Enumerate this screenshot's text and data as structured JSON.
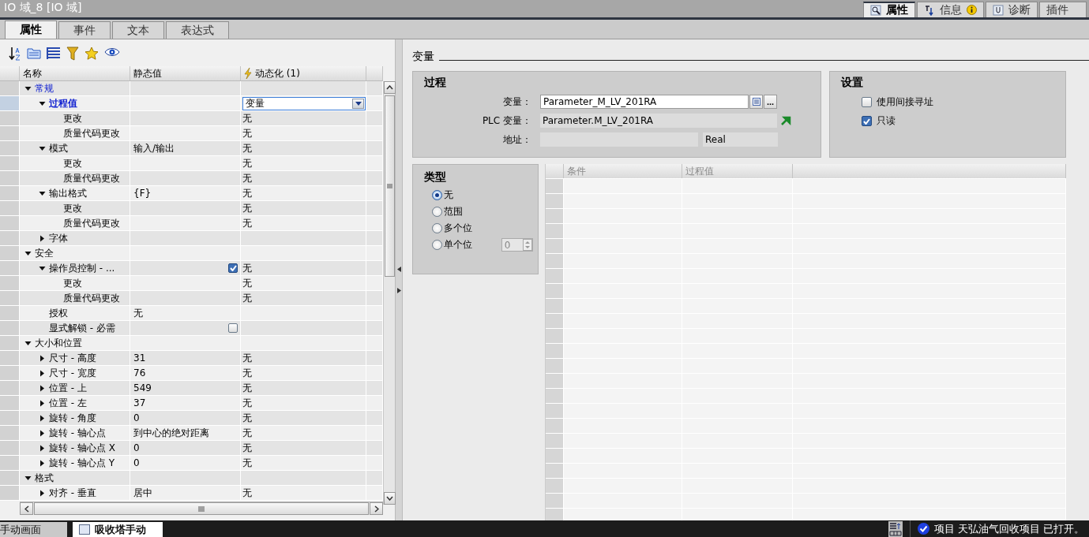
{
  "window": {
    "title": "IO 域_8 [IO 域]"
  },
  "inspector_tabs": [
    {
      "label": "属性",
      "selected": true,
      "kind": "properties"
    },
    {
      "label": "信息",
      "selected": false,
      "kind": "info"
    },
    {
      "label": "诊断",
      "selected": false,
      "kind": "diagnostics"
    },
    {
      "label": "插件",
      "selected": false,
      "kind": "plain"
    }
  ],
  "tabs": [
    {
      "label": "属性",
      "selected": true
    },
    {
      "label": "事件",
      "selected": false
    },
    {
      "label": "文本",
      "selected": false
    },
    {
      "label": "表达式",
      "selected": false
    }
  ],
  "grid": {
    "columns": [
      "名称",
      "静态值",
      "动态化 (1)"
    ],
    "rows": [
      {
        "name": "常规",
        "selected": false,
        "expanded": true,
        "children": [
          {
            "name": "过程值",
            "selected": true,
            "expanded": true,
            "dynamic": "变量",
            "children": [
              {
                "name": "更改",
                "selected": false,
                "dynamic": "无"
              },
              {
                "name": "质量代码更改",
                "selected": false,
                "dynamic": "无"
              }
            ]
          },
          {
            "name": "模式",
            "kind": "text",
            "selected": false,
            "expanded": true,
            "static": "输入/输出",
            "dynamic": "无",
            "children": [
              {
                "name": "更改",
                "selected": false,
                "dynamic": "无"
              },
              {
                "name": "质量代码更改",
                "selected": false,
                "dynamic": "无"
              }
            ]
          },
          {
            "name": "输出格式",
            "kind": "text",
            "selected": false,
            "expanded": true,
            "static": "{F}",
            "dynamic": "无",
            "children": [
              {
                "name": "更改",
                "selected": false,
                "dynamic": "无"
              },
              {
                "name": "质量代码更改",
                "selected": false,
                "dynamic": "无"
              }
            ]
          },
          {
            "name": "字体",
            "selected": false,
            "expanded": false
          }
        ]
      },
      {
        "name": "安全",
        "selected": false,
        "expanded": true,
        "children": [
          {
            "name": "操作员控制 - ...",
            "kind": "checkbox",
            "checked": true,
            "selected": false,
            "expanded": true,
            "dynamic": "无",
            "children": [
              {
                "name": "更改",
                "selected": false,
                "dynamic": "无"
              },
              {
                "name": "质量代码更改",
                "selected": false,
                "dynamic": "无"
              }
            ]
          },
          {
            "name": "授权",
            "kind": "text",
            "selected": false,
            "static": "无"
          },
          {
            "name": "显式解锁 - 必需",
            "kind": "checkbox",
            "checked": false,
            "selected": false
          }
        ]
      },
      {
        "name": "大小和位置",
        "selected": false,
        "expanded": true,
        "children": [
          {
            "name": "尺寸 - 高度",
            "kind": "text",
            "selected": false,
            "expanded": false,
            "static": "31",
            "dynamic": "无"
          },
          {
            "name": "尺寸 - 宽度",
            "kind": "text",
            "selected": false,
            "expanded": false,
            "static": "76",
            "dynamic": "无"
          },
          {
            "name": "位置 - 上",
            "kind": "text",
            "selected": false,
            "expanded": false,
            "static": "549",
            "dynamic": "无"
          },
          {
            "name": "位置 - 左",
            "kind": "text",
            "selected": false,
            "expanded": false,
            "static": "37",
            "dynamic": "无"
          },
          {
            "name": "旋转 - 角度",
            "kind": "text",
            "selected": false,
            "expanded": false,
            "static": "0",
            "dynamic": "无"
          },
          {
            "name": "旋转 - 轴心点",
            "kind": "text",
            "selected": false,
            "expanded": false,
            "static": "到中心的绝对距离",
            "dynamic": "无"
          },
          {
            "name": "旋转 - 轴心点 X",
            "kind": "text",
            "selected": false,
            "expanded": false,
            "static": "0",
            "dynamic": "无"
          },
          {
            "name": "旋转 - 轴心点 Y",
            "kind": "text",
            "selected": false,
            "expanded": false,
            "static": "0",
            "dynamic": "无"
          }
        ]
      },
      {
        "name": "格式",
        "selected": false,
        "expanded": true,
        "children": [
          {
            "name": "对齐 - 垂直",
            "kind": "text",
            "selected": false,
            "expanded": false,
            "static": "居中",
            "dynamic": "无"
          }
        ]
      }
    ]
  },
  "variable": {
    "title": "变量",
    "process": {
      "title": "过程",
      "fields": [
        {
          "label": "变量：",
          "kind": "input",
          "value": "Parameter_M_LV_201RA",
          "button": "..."
        },
        {
          "label": "PLC 变量：",
          "kind": "readonly",
          "value": "Parameter.M_LV_201RA"
        },
        {
          "label": "地址：",
          "kind": "split",
          "type": "Real"
        }
      ]
    },
    "settings": {
      "title": "设置",
      "options": [
        {
          "label": "使用间接寻址",
          "checked": false
        },
        {
          "label": "只读",
          "checked": true
        }
      ]
    },
    "type": {
      "title": "类型",
      "options": [
        {
          "label": "无",
          "selected": true
        },
        {
          "label": "范围",
          "selected": false
        },
        {
          "label": "多个位",
          "selected": false
        },
        {
          "label": "单个位",
          "selected": false,
          "spinner": "0"
        }
      ]
    },
    "table": {
      "columns": [
        "条件",
        "过程值"
      ]
    }
  },
  "taskbar": {
    "tabs": [
      {
        "label": "手动画面",
        "selected": false
      },
      {
        "label": "吸收塔手动",
        "selected": true
      }
    ],
    "status": "项目 天弘油气回收项目 已打开。"
  }
}
